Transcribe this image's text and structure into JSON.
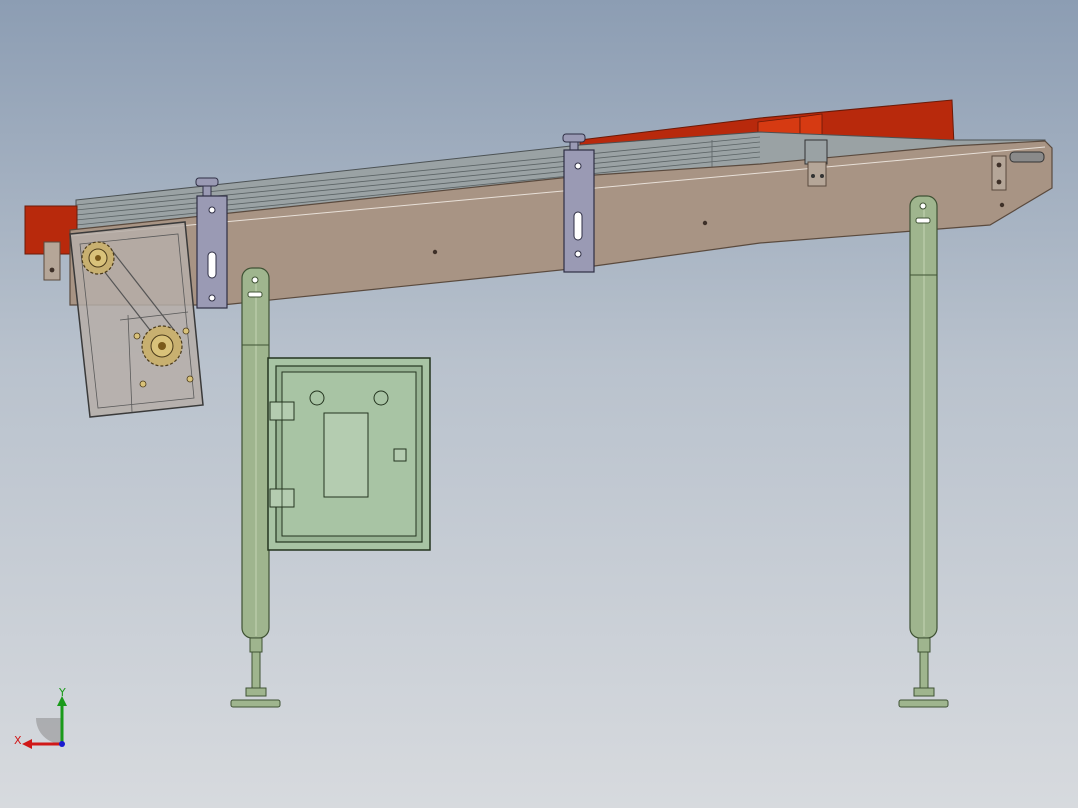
{
  "view": {
    "background_top": "#8c9db3",
    "background_bottom": "#d7dade"
  },
  "colors": {
    "frame": "#a89484",
    "frame_edge": "#5a4a3e",
    "product": "#b8290c",
    "product_light": "#d63a12",
    "belt": "#9aa2a4",
    "belt_edge": "#4c5254",
    "leg": "#9fb58e",
    "leg_edge": "#3f5234",
    "panel": "#a8c4a4",
    "panel_edge": "#24351f",
    "bracket": "#9a9ab4",
    "sprocket": "#d9c27a",
    "guard": "#b6aea8"
  },
  "triad": {
    "x_label": "X",
    "y_label": "Y",
    "x_color": "#d01818",
    "y_color": "#1a9a1a",
    "z_color": "#1a1ad0"
  }
}
